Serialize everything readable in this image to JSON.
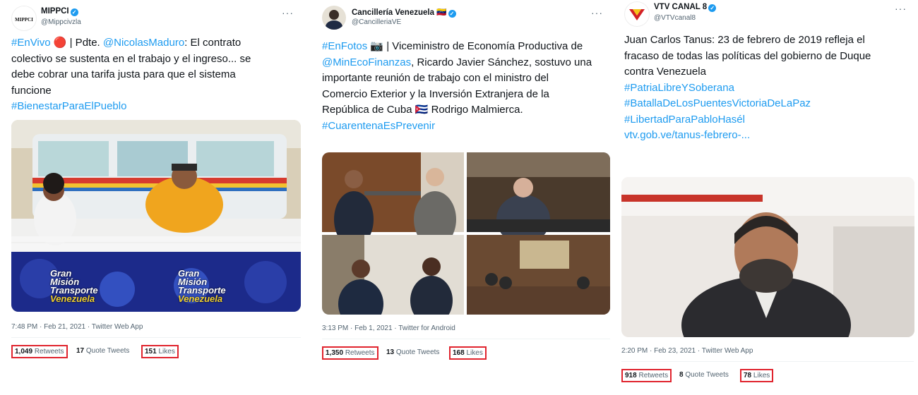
{
  "tweets": [
    {
      "account": {
        "name": "MIPPCI",
        "handle": "@Mippcivzla",
        "logo_text": "MIPPCI"
      },
      "lines": [
        [
          {
            "t": "#EnVivo",
            "c": "link"
          },
          {
            "t": " 🔴 | Pdte. ",
            "c": "plain"
          },
          {
            "t": "@NicolasMaduro",
            "c": "link"
          },
          {
            "t": ": El contrato",
            "c": "plain"
          }
        ],
        [
          {
            "t": "colectivo se sustenta en el trabajo y el ingreso... se",
            "c": "plain"
          }
        ],
        [
          {
            "t": "debe cobrar una tarifa justa para que el sistema",
            "c": "plain"
          }
        ],
        [
          {
            "t": "funcione",
            "c": "plain"
          }
        ],
        [
          {
            "t": "#BienestarParaElPueblo",
            "c": "link"
          }
        ]
      ],
      "media_caption": [
        "Gran",
        "Misión",
        "Transporte",
        "Venezuela"
      ],
      "timestamp": "7:48 PM · Feb 21, 2021 · Twitter Web App",
      "stats": {
        "retweets": "1,049",
        "retweets_label": "Retweets",
        "quotes": "17",
        "quotes_label": "Quote Tweets",
        "likes": "151",
        "likes_label": "Likes"
      }
    },
    {
      "account": {
        "name": "Cancillería Venezuela 🇻🇪",
        "handle": "@CancilleriaVE"
      },
      "lines": [
        [
          {
            "t": "#EnFotos",
            "c": "link"
          },
          {
            "t": " 📷 | Viceministro de Economía Productiva de",
            "c": "plain"
          }
        ],
        [
          {
            "t": "@MinEcoFinanzas",
            "c": "link"
          },
          {
            "t": ", Ricardo Javier Sánchez, sostuvo una",
            "c": "plain"
          }
        ],
        [
          {
            "t": "importante reunión de trabajo con el ministro del",
            "c": "plain"
          }
        ],
        [
          {
            "t": "Comercio Exterior y la Inversión Extranjera de la",
            "c": "plain"
          }
        ],
        [
          {
            "t": "República de Cuba 🇨🇺 Rodrigo Malmierca.",
            "c": "plain"
          }
        ],
        [
          {
            "t": " ",
            "c": "plain"
          }
        ],
        [
          {
            "t": "#CuarentenaEsPrevenir",
            "c": "link"
          }
        ]
      ],
      "timestamp": "3:13 PM · Feb 1, 2021 · Twitter for Android",
      "stats": {
        "retweets": "1,350",
        "retweets_label": "Retweets",
        "quotes": "13",
        "quotes_label": "Quote Tweets",
        "likes": "168",
        "likes_label": "Likes"
      }
    },
    {
      "account": {
        "name": "VTV CANAL 8",
        "handle": "@VTVcanal8"
      },
      "lines": [
        [
          {
            "t": "Juan Carlos Tanus: 23 de febrero de 2019 refleja el",
            "c": "plain"
          }
        ],
        [
          {
            "t": "fracaso de todas las políticas del gobierno de Duque",
            "c": "plain"
          }
        ],
        [
          {
            "t": "contra Venezuela",
            "c": "plain"
          }
        ],
        [
          {
            "t": " ",
            "c": "plain"
          }
        ],
        [
          {
            "t": "#PatriaLibreYSoberana",
            "c": "link"
          }
        ],
        [
          {
            "t": "#BatallaDeLosPuentesVictoriaDeLaPaz",
            "c": "link"
          }
        ],
        [
          {
            "t": "#LibertadParaPabloHasél",
            "c": "link"
          }
        ],
        [
          {
            "t": " ",
            "c": "plain"
          }
        ],
        [
          {
            "t": "vtv.gob.ve/tanus-febrero-...",
            "c": "link"
          }
        ]
      ],
      "timestamp": "2:20 PM · Feb 23, 2021 · Twitter Web App",
      "stats": {
        "retweets": "918",
        "retweets_label": "Retweets",
        "quotes": "8",
        "quotes_label": "Quote Tweets",
        "likes": "78",
        "likes_label": "Likes"
      }
    }
  ],
  "icons": {
    "verified": "verified-badge-icon",
    "more": "more-options-icon"
  },
  "colors": {
    "link": "#1d9bf0",
    "highlight": "#e0242e",
    "text": "#0f1419",
    "muted": "#536471"
  }
}
